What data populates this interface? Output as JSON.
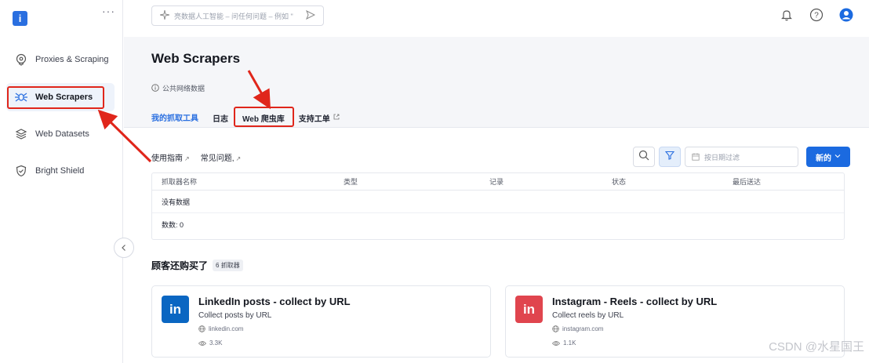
{
  "app": {
    "logo_text": "i",
    "more_label": "···"
  },
  "sidebar": {
    "items": [
      {
        "label": "Proxies & Scraping",
        "icon": "location-pin-icon"
      },
      {
        "label": "Web Scrapers",
        "icon": "spider-icon",
        "active": true
      },
      {
        "label": "Web Datasets",
        "icon": "layers-icon"
      },
      {
        "label": "Bright Shield",
        "icon": "shield-icon"
      }
    ]
  },
  "topbar": {
    "ai_placeholder": "亮数据人工智能 – 问任何问题 – 例如 \""
  },
  "header": {
    "title": "Web Scrapers",
    "info": "公共网络数据",
    "tabs": [
      {
        "label": "我的抓取工具",
        "active": true
      },
      {
        "label": "日志"
      },
      {
        "label": "Web 爬虫库"
      },
      {
        "label": "支持工单",
        "external": true
      }
    ]
  },
  "content": {
    "links": [
      {
        "label": "使用指南"
      },
      {
        "label": "常见问题,"
      }
    ],
    "date_placeholder": "按日期过滤",
    "new_button": "新的",
    "table": {
      "columns": [
        "抓取器名称",
        "类型",
        "记录",
        "状态",
        "最后送达"
      ],
      "empty_text": "没有数据",
      "count_text": "数数: 0"
    },
    "section": {
      "title": "顾客还购买了",
      "badge": "6 抓取器"
    },
    "cards": [
      {
        "title": "LinkedIn posts - collect by URL",
        "subtitle": "Collect posts by URL",
        "domain": "linkedin.com",
        "views": "3.3K",
        "logo": "in",
        "color": "#0a66c2"
      },
      {
        "title": "Instagram - Reels - collect by URL",
        "subtitle": "Collect reels by URL",
        "domain": "instagram.com",
        "views": "1.1K",
        "logo": "in",
        "color": "#e0454e"
      }
    ]
  },
  "watermark": "CSDN @水星国王"
}
